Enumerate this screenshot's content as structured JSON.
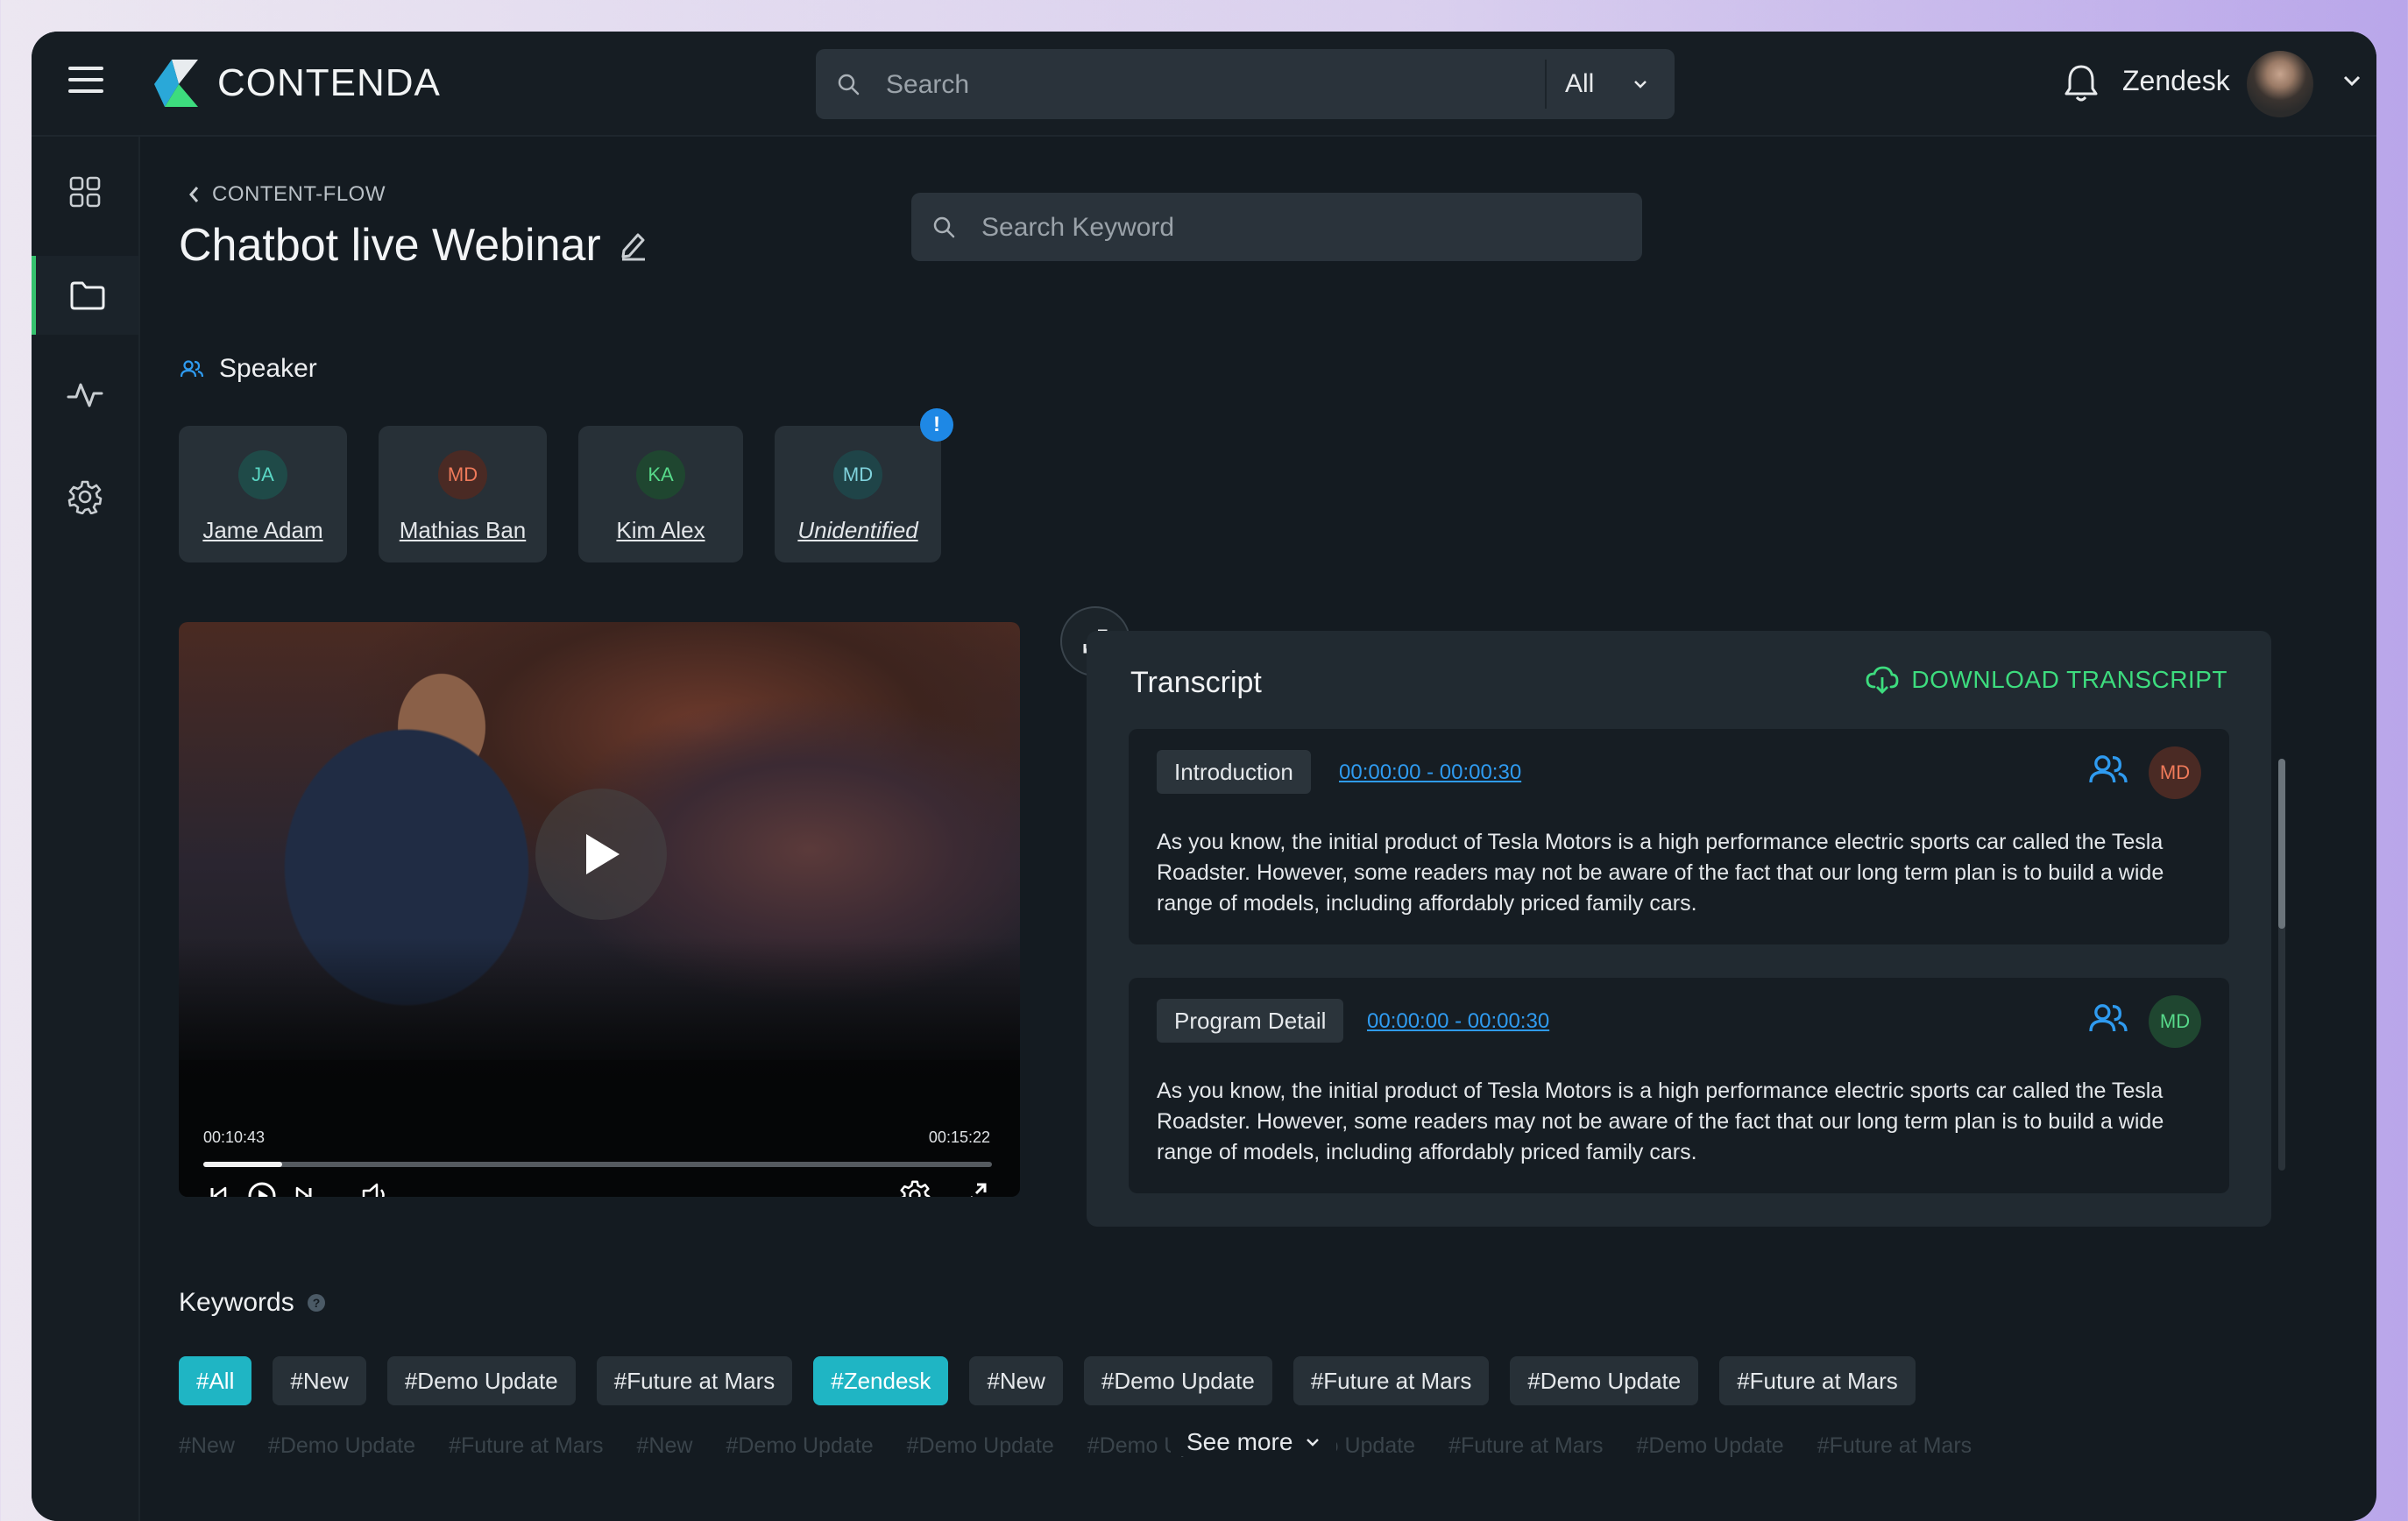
{
  "app": {
    "brand": "CONTENDA",
    "brand_colors": [
      "#3ddc7e",
      "#2aa8d8"
    ]
  },
  "topbar": {
    "search_placeholder": "Search",
    "filter_value": "All",
    "user_name": "Zendesk"
  },
  "sidebar": {
    "items": [
      {
        "icon": "dashboard-grid-icon"
      },
      {
        "icon": "folder-icon",
        "active": true
      },
      {
        "icon": "activity-pulse-icon"
      },
      {
        "icon": "settings-gear-icon"
      }
    ]
  },
  "page": {
    "breadcrumb": "CONTENT-FLOW",
    "title": "Chatbot live Webinar",
    "keyword_search_placeholder": "Search Keyword"
  },
  "speakers": {
    "heading": "Speaker",
    "list": [
      {
        "initials": "JA",
        "name": "Jame Adam",
        "bg": "#1f4a48",
        "fg": "#5ad6c4"
      },
      {
        "initials": "MD",
        "name": "Mathias Ban",
        "bg": "#4a2a24",
        "fg": "#ef7a5a"
      },
      {
        "initials": "KA",
        "name": "Kim Alex",
        "bg": "#1f4630",
        "fg": "#57d98a"
      },
      {
        "initials": "MD",
        "name": "Unidentified",
        "bg": "#1f4448",
        "fg": "#7fd2dc",
        "alert": "!"
      }
    ]
  },
  "video": {
    "current_time": "00:10:43",
    "total_time": "00:15:22",
    "progress_fraction": 0.1
  },
  "transcript": {
    "title": "Transcript",
    "download_label": "DOWNLOAD TRANSCRIPT",
    "sections": [
      {
        "tag": "Introduction",
        "time": "00:00:00 - 00:00:30",
        "speaker_initials": "MD",
        "badge_bg": "#4a2a24",
        "badge_fg": "#ef7a5a",
        "text": "As you know, the initial product of Tesla Motors is a high performance electric sports car called the Tesla Roadster. However, some readers may not be aware of the fact that our long term plan is to build a wide range of models, including affordably priced family cars."
      },
      {
        "tag": "Program Detail",
        "time": "00:00:00 - 00:00:30",
        "speaker_initials": "MD",
        "badge_bg": "#1f4630",
        "badge_fg": "#57d98a",
        "text": "As you know, the initial product of Tesla Motors is a high performance electric sports car called the Tesla Roadster. However, some readers may not be aware of the fact that our long term plan is to build a wide range of models, including affordably priced family cars."
      }
    ]
  },
  "keywords": {
    "heading": "Keywords",
    "chips": [
      {
        "label": "#All",
        "active": true
      },
      {
        "label": "#New"
      },
      {
        "label": "#Demo Update"
      },
      {
        "label": "#Future at Mars"
      },
      {
        "label": "#Zendesk",
        "active": true
      },
      {
        "label": "#New"
      },
      {
        "label": "#Demo Update"
      },
      {
        "label": "#Future at Mars"
      },
      {
        "label": "#Demo Update"
      },
      {
        "label": "#Future at Mars"
      }
    ],
    "faded": [
      "#New",
      "#Demo Update",
      "#Future at Mars",
      "#New",
      "#Demo Update",
      "#Demo Update",
      "#Demo Update",
      "#Demo Update",
      "#Future at Mars",
      "#Demo Update",
      "#Future at Mars"
    ],
    "see_more": "See more"
  }
}
